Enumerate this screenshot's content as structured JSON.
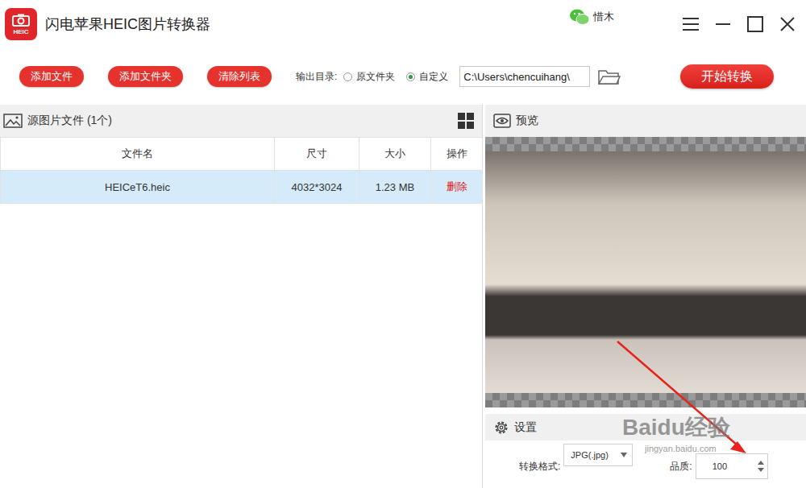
{
  "app": {
    "logo_text": "HEIC",
    "title": "闪电苹果HEIC图片转换器",
    "user": "惜木"
  },
  "toolbar": {
    "buttons": [
      "添加文件",
      "添加文件夹",
      "清除列表"
    ],
    "output_label": "输出目录:",
    "output_options": [
      {
        "label": "原文件夹",
        "selected": false
      },
      {
        "label": "自定义",
        "selected": true
      }
    ],
    "path": "C:\\Users\\chencuihang\\",
    "start_button": "开始转换"
  },
  "file_panel": {
    "title": "源图片文件 (1个)",
    "columns": [
      "文件名",
      "尺寸",
      "大小",
      "操作"
    ],
    "rows": [
      {
        "cells": [
          "HEICeT6.heic",
          "4032*3024",
          "1.23 MB"
        ],
        "action": "删除",
        "selected": true
      }
    ]
  },
  "preview": {
    "title": "预览"
  },
  "settings": {
    "title": "设置",
    "format_label": "转换格式:",
    "format": "JPG(.jpg)",
    "quality_label": "品质:",
    "quality": "100"
  },
  "watermark": {
    "brand": "Baidu经验",
    "url": "jingyan.baidu.com"
  }
}
